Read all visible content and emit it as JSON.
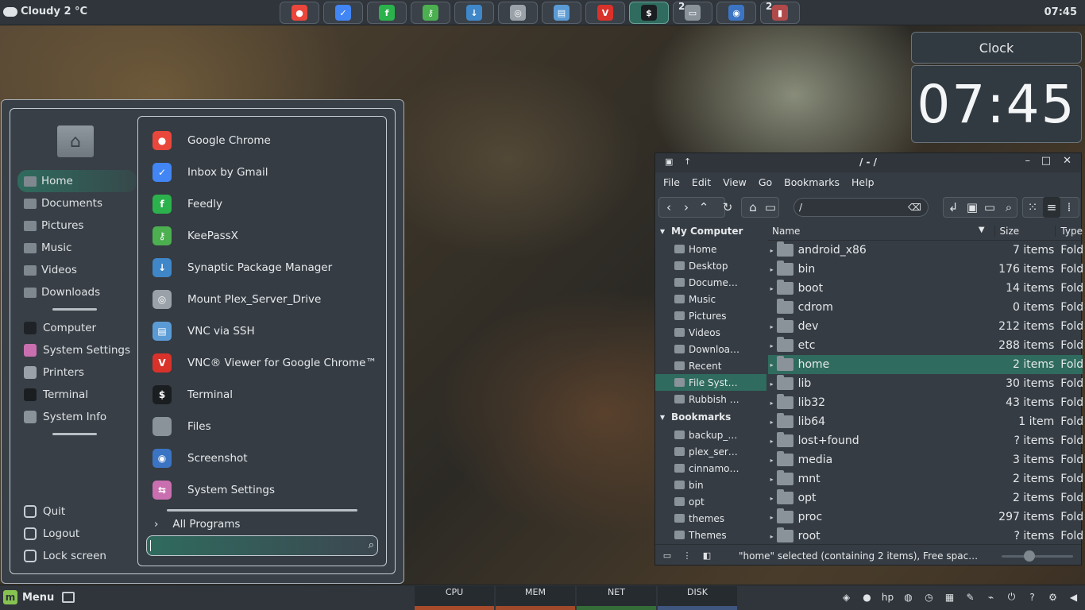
{
  "top_panel": {
    "weather": "Cloudy 2 °C",
    "clock": "07:45",
    "tasks": [
      {
        "icon": "chrome-icon",
        "color": "#e9473b",
        "glyph": "●",
        "count": ""
      },
      {
        "icon": "inbox-icon",
        "color": "#4285f4",
        "glyph": "✓",
        "count": ""
      },
      {
        "icon": "feedly-icon",
        "color": "#2bb24c",
        "glyph": "f",
        "count": ""
      },
      {
        "icon": "keepassx-icon",
        "color": "#4caf50",
        "glyph": "⚷",
        "count": ""
      },
      {
        "icon": "synaptic-icon",
        "color": "#3f87c8",
        "glyph": "↓",
        "count": ""
      },
      {
        "icon": "disk-mount-icon",
        "color": "#9aa1a8",
        "glyph": "◎",
        "count": ""
      },
      {
        "icon": "vnc-ssh-icon",
        "color": "#5b9bd5",
        "glyph": "▤",
        "count": ""
      },
      {
        "icon": "vnc-viewer-icon",
        "color": "#d9322b",
        "glyph": "V",
        "count": ""
      },
      {
        "icon": "terminal-icon",
        "color": "#1b1e21",
        "glyph": "$",
        "count": ""
      },
      {
        "icon": "files-icon",
        "color": "#8a929a",
        "glyph": "▭",
        "count": "2"
      },
      {
        "icon": "screenshot-icon",
        "color": "#3c74c4",
        "glyph": "◉",
        "count": ""
      },
      {
        "icon": "text-editor-icon",
        "color": "#b04a4a",
        "glyph": "▮",
        "count": "2"
      }
    ]
  },
  "desklet": {
    "title": "Clock",
    "time": "07:45"
  },
  "menu": {
    "places": [
      {
        "label": "Home",
        "icon": "home-folder-icon",
        "selected": true
      },
      {
        "label": "Documents",
        "icon": "documents-folder-icon"
      },
      {
        "label": "Pictures",
        "icon": "pictures-folder-icon"
      },
      {
        "label": "Music",
        "icon": "music-folder-icon"
      },
      {
        "label": "Videos",
        "icon": "videos-folder-icon"
      },
      {
        "label": "Downloads",
        "icon": "downloads-folder-icon"
      }
    ],
    "system": [
      {
        "label": "Computer",
        "icon": "computer-icon",
        "color": "#1f2327"
      },
      {
        "label": "System Settings",
        "icon": "settings-icon",
        "color": "#c96fb0"
      },
      {
        "label": "Printers",
        "icon": "printer-icon",
        "color": "#9aa1a8"
      },
      {
        "label": "Terminal",
        "icon": "terminal-icon",
        "color": "#1b1e21"
      },
      {
        "label": "System Info",
        "icon": "gear-icon",
        "color": "#8a929a"
      }
    ],
    "session": [
      {
        "label": "Quit",
        "icon": "power-icon"
      },
      {
        "label": "Logout",
        "icon": "logout-icon"
      },
      {
        "label": "Lock screen",
        "icon": "lock-icon"
      }
    ],
    "apps": [
      {
        "label": "Google Chrome",
        "icon": "chrome-icon",
        "color": "#e9473b",
        "glyph": "●"
      },
      {
        "label": "Inbox by Gmail",
        "icon": "inbox-icon",
        "color": "#4285f4",
        "glyph": "✓"
      },
      {
        "label": "Feedly",
        "icon": "feedly-icon",
        "color": "#2bb24c",
        "glyph": "f"
      },
      {
        "label": "KeePassX",
        "icon": "keepassx-icon",
        "color": "#4caf50",
        "glyph": "⚷"
      },
      {
        "label": "Synaptic Package Manager",
        "icon": "synaptic-icon",
        "color": "#3f87c8",
        "glyph": "↓"
      },
      {
        "label": "Mount Plex_Server_Drive",
        "icon": "disk-mount-icon",
        "color": "#9aa1a8",
        "glyph": "◎"
      },
      {
        "label": "VNC via SSH",
        "icon": "vnc-ssh-icon",
        "color": "#5b9bd5",
        "glyph": "▤"
      },
      {
        "label": "VNC® Viewer for Google Chrome™",
        "icon": "vnc-viewer-icon",
        "color": "#d9322b",
        "glyph": "V"
      },
      {
        "label": "Terminal",
        "icon": "terminal-icon",
        "color": "#1b1e21",
        "glyph": "$"
      },
      {
        "label": "Files",
        "icon": "files-icon",
        "color": "#8a929a",
        "glyph": ""
      },
      {
        "label": "Screenshot",
        "icon": "screenshot-icon",
        "color": "#3c74c4",
        "glyph": "◉"
      },
      {
        "label": "System Settings",
        "icon": "settings-icon",
        "color": "#c96fb0",
        "glyph": "⇆"
      }
    ],
    "all_programs": "All Programs",
    "search_value": ""
  },
  "file_manager": {
    "title": "/ - /",
    "menubar": [
      "File",
      "Edit",
      "View",
      "Go",
      "Bookmarks",
      "Help"
    ],
    "location": "/",
    "sidebar": {
      "my_computer": "My Computer",
      "computer_items": [
        {
          "label": "Home",
          "icon": "home-icon"
        },
        {
          "label": "Desktop",
          "icon": "desktop-icon"
        },
        {
          "label": "Docume…",
          "icon": "documents-icon"
        },
        {
          "label": "Music",
          "icon": "music-icon"
        },
        {
          "label": "Pictures",
          "icon": "pictures-icon"
        },
        {
          "label": "Videos",
          "icon": "videos-icon"
        },
        {
          "label": "Downloa…",
          "icon": "downloads-icon"
        },
        {
          "label": "Recent",
          "icon": "recent-icon"
        },
        {
          "label": "File Syst…",
          "icon": "filesystem-icon",
          "selected": true
        },
        {
          "label": "Rubbish …",
          "icon": "trash-icon"
        }
      ],
      "bookmarks": "Bookmarks",
      "bookmark_items": [
        {
          "label": "backup_…",
          "icon": "folder-icon"
        },
        {
          "label": "plex_ser…",
          "icon": "folder-icon"
        },
        {
          "label": "cinnamo…",
          "icon": "folder-icon"
        },
        {
          "label": "bin",
          "icon": "folder-icon"
        },
        {
          "label": "opt",
          "icon": "folder-icon"
        },
        {
          "label": "themes",
          "icon": "folder-icon"
        },
        {
          "label": "Themes",
          "icon": "folder-icon"
        }
      ]
    },
    "columns": {
      "name": "Name",
      "size": "Size",
      "type": "Type"
    },
    "rows": [
      {
        "name": "android_x86",
        "size": "7 items",
        "type": "Folder",
        "expand": true
      },
      {
        "name": "bin",
        "size": "176 items",
        "type": "Folder",
        "expand": true
      },
      {
        "name": "boot",
        "size": "14 items",
        "type": "Folder",
        "expand": true
      },
      {
        "name": "cdrom",
        "size": "0 items",
        "type": "Folder",
        "expand": false
      },
      {
        "name": "dev",
        "size": "212 items",
        "type": "Folder",
        "expand": true
      },
      {
        "name": "etc",
        "size": "288 items",
        "type": "Folder",
        "expand": true
      },
      {
        "name": "home",
        "size": "2 items",
        "type": "Folder",
        "expand": true,
        "selected": true
      },
      {
        "name": "lib",
        "size": "30 items",
        "type": "Folder",
        "expand": true
      },
      {
        "name": "lib32",
        "size": "43 items",
        "type": "Folder",
        "expand": true
      },
      {
        "name": "lib64",
        "size": "1 item",
        "type": "Folder",
        "expand": true
      },
      {
        "name": "lost+found",
        "size": "? items",
        "type": "Folder",
        "expand": true
      },
      {
        "name": "media",
        "size": "3 items",
        "type": "Folder",
        "expand": true
      },
      {
        "name": "mnt",
        "size": "2 items",
        "type": "Folder",
        "expand": true
      },
      {
        "name": "opt",
        "size": "2 items",
        "type": "Folder",
        "expand": true
      },
      {
        "name": "proc",
        "size": "297 items",
        "type": "Folder",
        "expand": true
      },
      {
        "name": "root",
        "size": "? items",
        "type": "Folder",
        "expand": true
      }
    ],
    "status": "\"home\" selected (containing 2 items), Free spac…"
  },
  "bottom_panel": {
    "menu_label": "Menu",
    "graphs": [
      "CPU",
      "MEM",
      "NET",
      "DISK"
    ],
    "tray": [
      {
        "icon": "shield-icon",
        "glyph": "◈"
      },
      {
        "icon": "chrome-icon",
        "glyph": "●"
      },
      {
        "icon": "hp-icon",
        "glyph": "hp"
      },
      {
        "icon": "network-globe-icon",
        "glyph": "◍"
      },
      {
        "icon": "clock-icon",
        "glyph": "◷"
      },
      {
        "icon": "keyboard-icon",
        "glyph": "▦"
      },
      {
        "icon": "pen-icon",
        "glyph": "✎"
      },
      {
        "icon": "usb-icon",
        "glyph": "⌁"
      },
      {
        "icon": "power-plug-icon",
        "glyph": "⏻"
      },
      {
        "icon": "help-icon",
        "glyph": "?"
      },
      {
        "icon": "settings-gear-icon",
        "glyph": "⚙"
      },
      {
        "icon": "volume-icon",
        "glyph": "◀"
      }
    ]
  }
}
